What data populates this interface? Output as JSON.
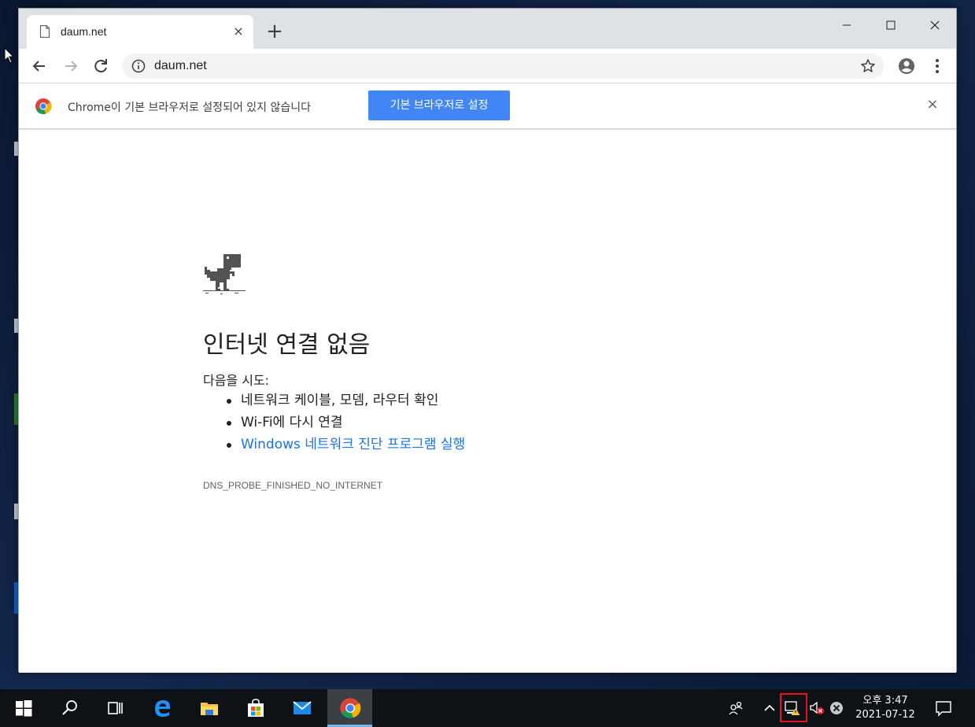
{
  "browser": {
    "tab": {
      "title": "daum.net",
      "close_label": "×"
    },
    "new_tab_label": "+",
    "omnibox": {
      "url": "daum.net"
    }
  },
  "infobar": {
    "message": "Chrome이 기본 브라우저로 설정되어 있지 않습니다",
    "button_label": "기본 브라우저로 설정",
    "close_label": "×"
  },
  "error_page": {
    "title": "인터넷 연결 없음",
    "try_label": "다음을 시도:",
    "suggestions": [
      "네트워크 케이블, 모뎀, 라우터 확인",
      "Wi-Fi에 다시 연결",
      "Windows 네트워크 진단 프로그램 실행"
    ],
    "error_code": "DNS_PROBE_FINISHED_NO_INTERNET"
  },
  "taskbar": {
    "clock_time": "오후 3:47",
    "clock_date": "2021-07-12"
  },
  "colors": {
    "accent_blue": "#4285f4",
    "link_blue": "#1a73e8",
    "tray_highlight": "#e81123"
  }
}
